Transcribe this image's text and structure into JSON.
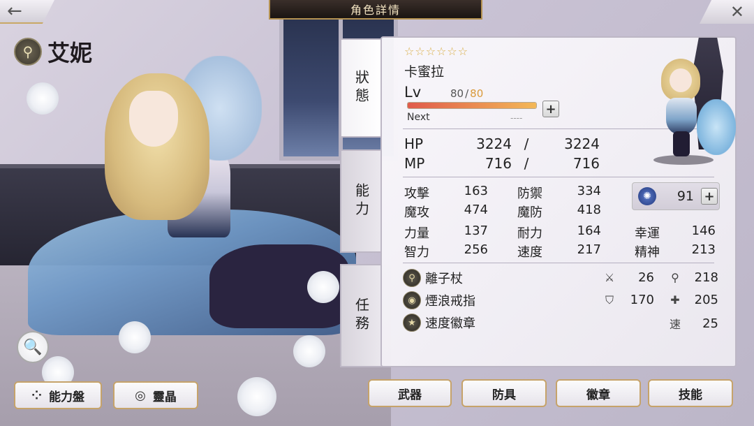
{
  "header": {
    "title": "角色詳情",
    "back_icon": "←",
    "close_icon": "✕"
  },
  "character": {
    "name": "艾妮",
    "weapon_type_icon": "⚲"
  },
  "zoom_icon": "🔍",
  "bottom_left": {
    "ability_board": {
      "icon": "⁘",
      "label": "能力盤"
    },
    "spirit_crystal": {
      "icon": "◎",
      "label": "靈晶"
    }
  },
  "side_tabs": [
    {
      "label": "狀態"
    },
    {
      "label": "能力"
    },
    {
      "label": "任務"
    }
  ],
  "status": {
    "stars": "☆☆☆☆☆☆",
    "star_count": 6,
    "title": "卡蜜拉",
    "lv_label": "Lv",
    "level_current": "80",
    "level_sep": "/",
    "level_max": "80",
    "exp_fraction": 1.0,
    "next_label": "Next",
    "next_value": "----",
    "hp_label": "HP",
    "hp_current": "3224",
    "hp_sep": "/",
    "hp_max": "3224",
    "mp_label": "MP",
    "mp_current": "716",
    "mp_sep": "/",
    "mp_max": "716",
    "stats_a": [
      {
        "label": "攻擊",
        "value": "163"
      },
      {
        "label": "魔攻",
        "value": "474"
      }
    ],
    "stats_b": [
      {
        "label": "防禦",
        "value": "334"
      },
      {
        "label": "魔防",
        "value": "418"
      }
    ],
    "gem_value": "91",
    "stats_c": [
      {
        "label": "力量",
        "value": "137"
      },
      {
        "label": "智力",
        "value": "256"
      }
    ],
    "stats_d": [
      {
        "label": "耐力",
        "value": "164"
      },
      {
        "label": "速度",
        "value": "217"
      }
    ],
    "stats_e": [
      {
        "label": "幸運",
        "value": "146"
      },
      {
        "label": "精神",
        "value": "213"
      }
    ],
    "equipment": [
      {
        "name": "離子杖",
        "stat1_icon": "sword-icon",
        "stat1": "26",
        "stat2_icon": "staff-icon",
        "stat2": "218"
      },
      {
        "name": "煙浪戒指",
        "stat1_icon": "shield-icon",
        "stat1": "170",
        "stat2_icon": "magic-shield-icon",
        "stat2": "205"
      },
      {
        "name": "速度徽章",
        "stat1_label": "速",
        "stat1": "25"
      }
    ]
  },
  "bottom_tabs": [
    {
      "label": "武器"
    },
    {
      "label": "防具"
    },
    {
      "label": "徽章"
    },
    {
      "label": "技能"
    }
  ]
}
